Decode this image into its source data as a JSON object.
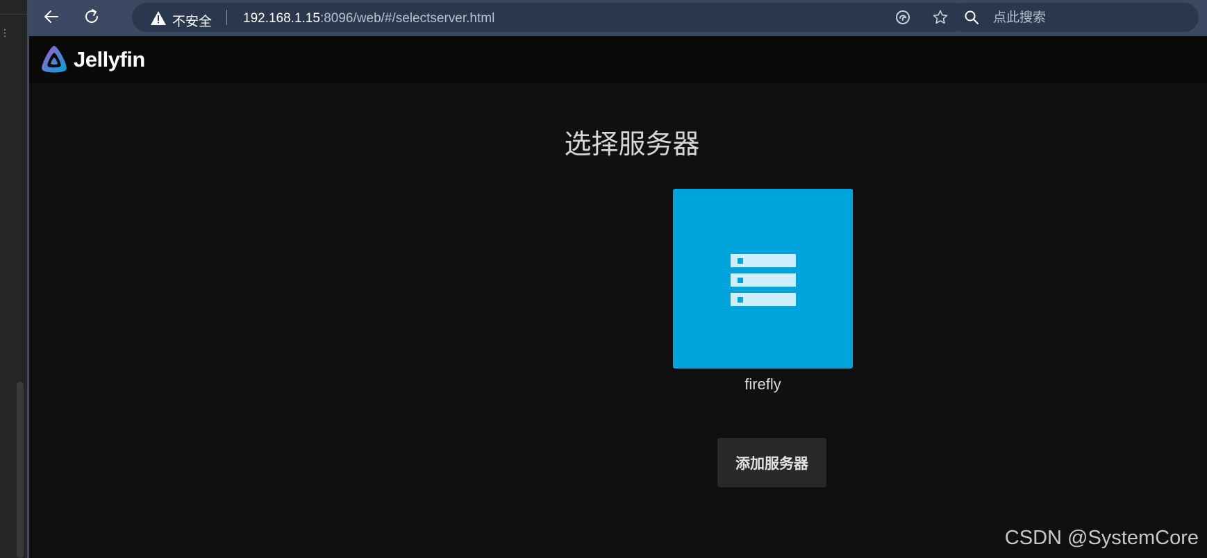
{
  "browser": {
    "security_label": "不安全",
    "url_host": "192.168.1.15",
    "url_rest": ":8096/web/#/selectserver.html",
    "search_placeholder": "点此搜索"
  },
  "app": {
    "name": "Jellyfin"
  },
  "select_server": {
    "title": "选择服务器",
    "servers": [
      {
        "name": "firefly"
      }
    ],
    "add_server_label": "添加服务器"
  },
  "watermark": "CSDN @SystemCore",
  "colors": {
    "accent": "#00a4dc",
    "toolbar": "#3b4a62",
    "background": "#101010"
  }
}
